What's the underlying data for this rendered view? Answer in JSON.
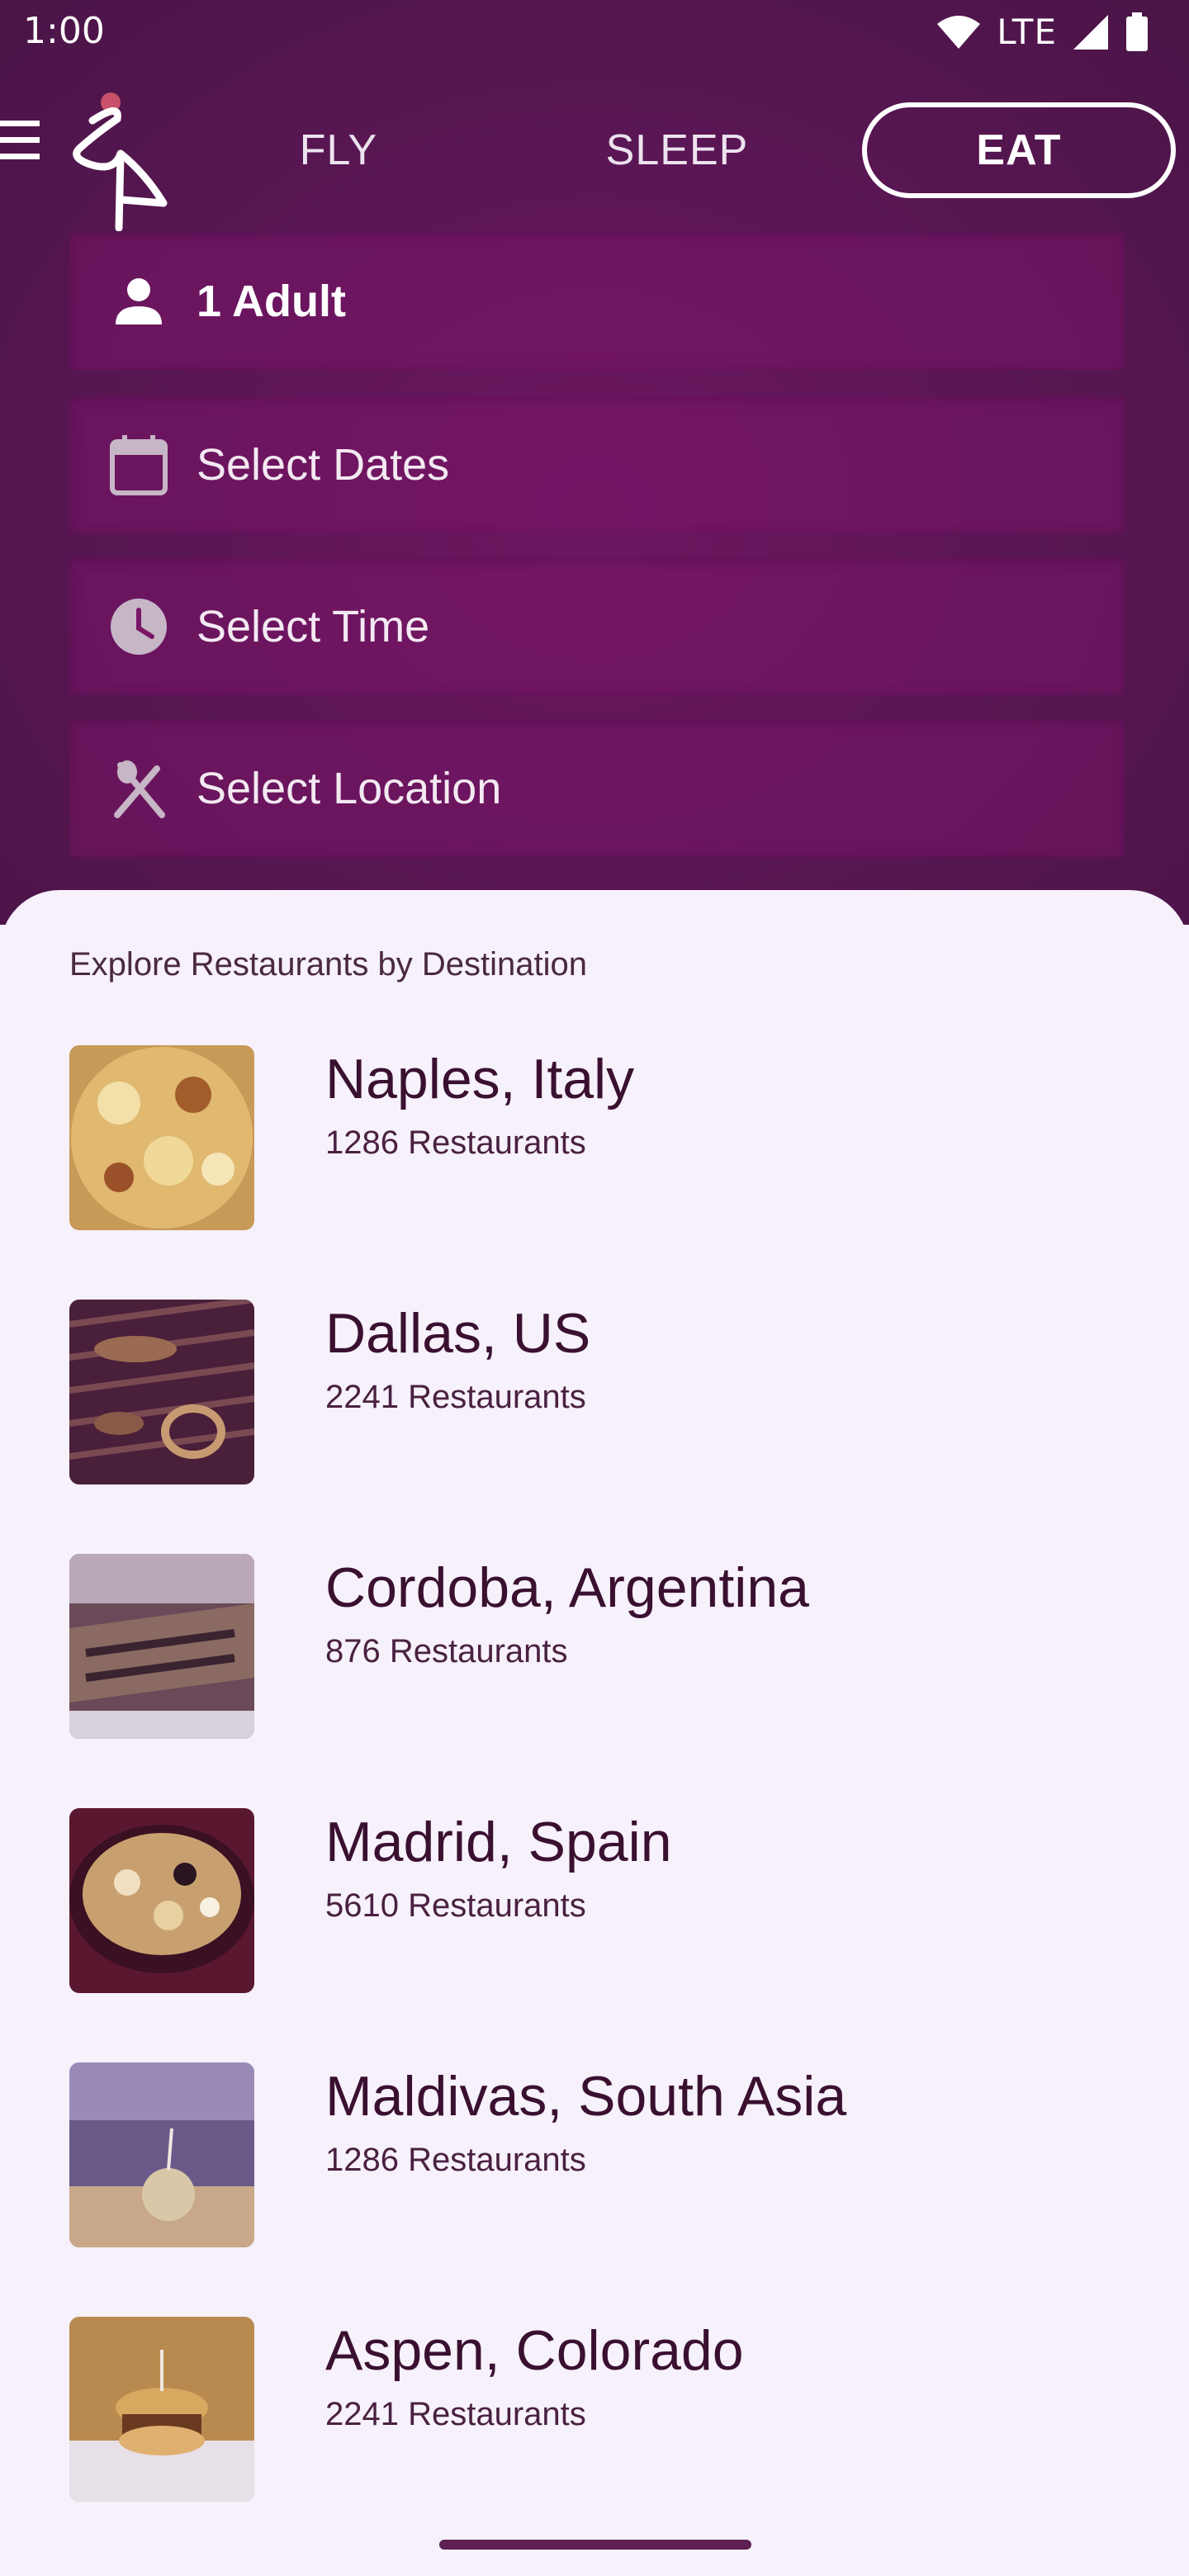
{
  "status_bar": {
    "time": "1:00",
    "network": "LTE"
  },
  "nav": {
    "tabs": [
      {
        "label": "FLY",
        "selected": false
      },
      {
        "label": "SLEEP",
        "selected": false
      },
      {
        "label": "EAT",
        "selected": true
      }
    ]
  },
  "search_fields": {
    "travelers": "1 Adult",
    "dates": "Select Dates",
    "time": "Select Time",
    "location": "Select Location"
  },
  "explore": {
    "title": "Explore Restaurants by Destination",
    "destinations": [
      {
        "name": "Naples, Italy",
        "count": "1286 Restaurants"
      },
      {
        "name": "Dallas, US",
        "count": "2241 Restaurants"
      },
      {
        "name": "Cordoba, Argentina",
        "count": "876 Restaurants"
      },
      {
        "name": "Madrid, Spain",
        "count": "5610 Restaurants"
      },
      {
        "name": "Maldivas, South Asia",
        "count": "1286 Restaurants"
      },
      {
        "name": "Aspen, Colorado",
        "count": "2241 Restaurants"
      }
    ]
  },
  "colors": {
    "header_bg": "#5c1656",
    "field_bg": "#7a1668",
    "sheet_bg": "#f6f1fb",
    "text_dark": "#3a1030"
  }
}
